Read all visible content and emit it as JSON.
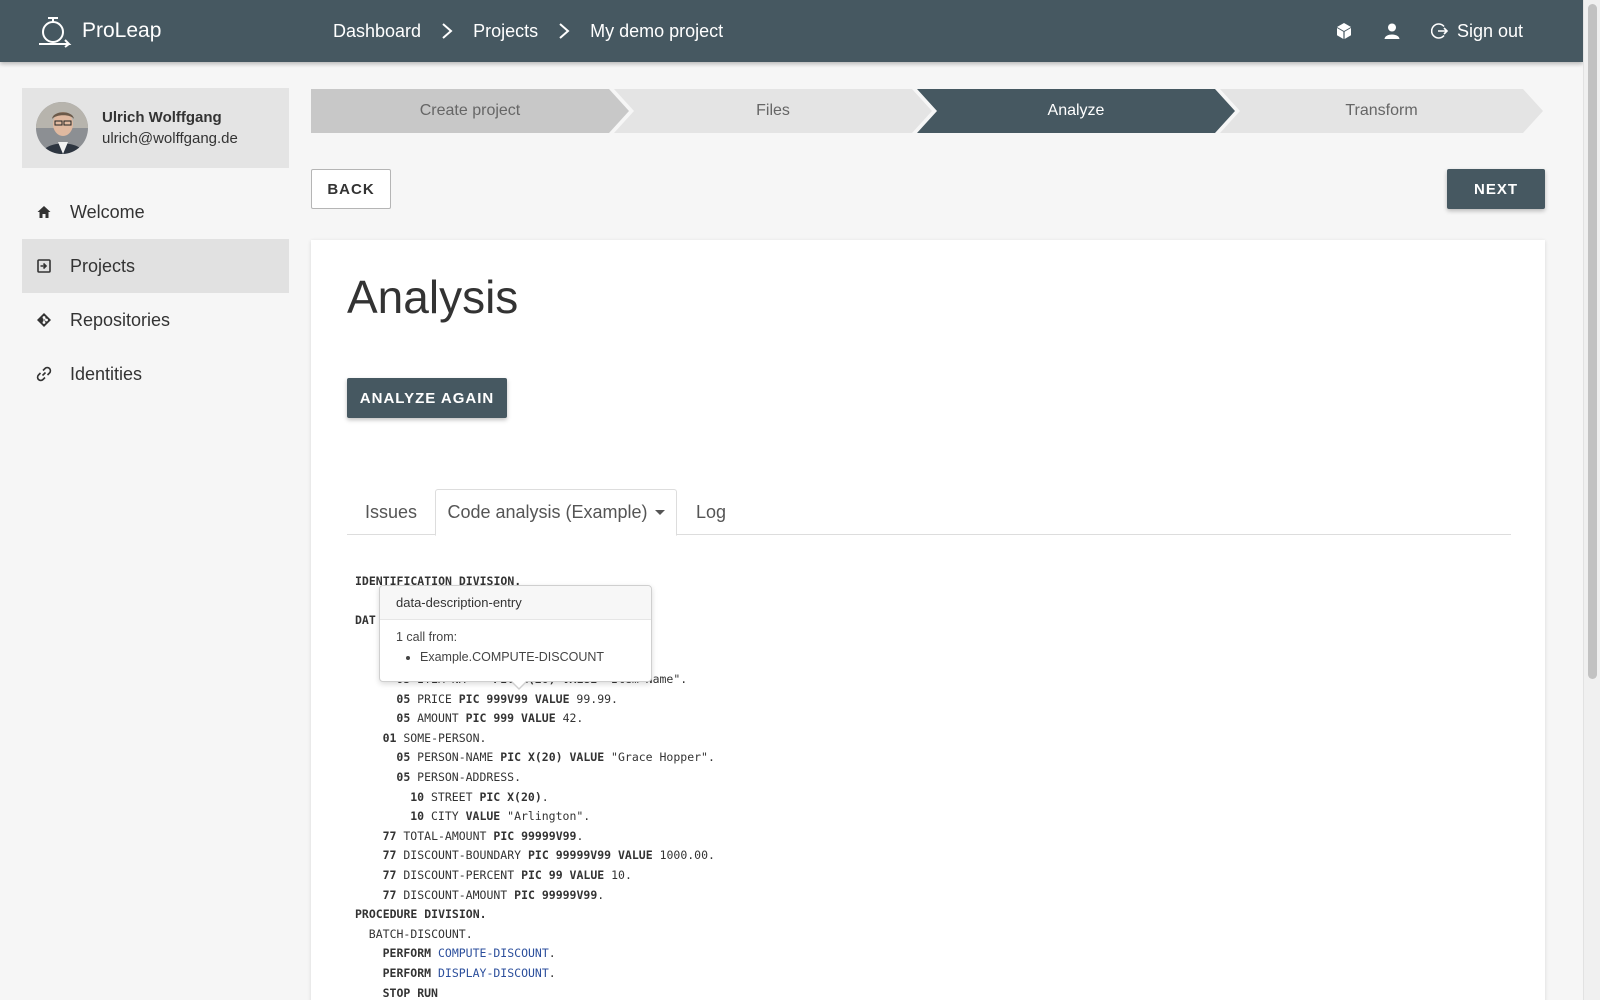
{
  "app": {
    "brand": "ProLeap"
  },
  "breadcrumb": [
    "Dashboard",
    "Projects",
    "My demo project"
  ],
  "topbar": {
    "sign_out": "Sign out",
    "icons": [
      "cube-icon",
      "user-icon",
      "sign-out-icon"
    ]
  },
  "user": {
    "name": "Ulrich Wolffgang",
    "email": "ulrich@wolffgang.de"
  },
  "sidebar": {
    "items": [
      {
        "label": "Welcome",
        "icon": "home-icon",
        "active": false
      },
      {
        "label": "Projects",
        "icon": "projects-icon",
        "active": true
      },
      {
        "label": "Repositories",
        "icon": "git-icon",
        "active": false
      },
      {
        "label": "Identities",
        "icon": "link-icon",
        "active": false
      }
    ]
  },
  "stepper": {
    "steps": [
      "Create project",
      "Files",
      "Analyze",
      "Transform"
    ],
    "active": "Analyze"
  },
  "actions": {
    "back": "BACK",
    "next": "NEXT"
  },
  "main": {
    "title": "Analysis",
    "analyze_again": "ANALYZE AGAIN",
    "tabs": [
      "Issues",
      "Code analysis (Example)",
      "Log"
    ],
    "active_tab": "Code analysis (Example)"
  },
  "code_lines": [
    {
      "indent": 0,
      "parts": [
        [
          "kw",
          "IDENTIFICATION DIVISION."
        ]
      ]
    },
    {
      "indent": 0,
      "parts": [
        [
          "kw",
          "DAT"
        ]
      ]
    },
    {
      "indent": 6,
      "parts": [
        [
          "kw",
          "05 "
        ],
        [
          "t",
          "ITEM-NA"
        ],
        [
          "t",
          "    "
        ],
        [
          "kw",
          "PIC X(20) VALUE "
        ],
        [
          "t",
          "\"Item Name\"."
        ]
      ]
    },
    {
      "indent": 6,
      "parts": [
        [
          "kw",
          "05 "
        ],
        [
          "t",
          "PRICE "
        ],
        [
          "kw",
          "PIC 999V99 VALUE "
        ],
        [
          "t",
          "99.99."
        ]
      ]
    },
    {
      "indent": 6,
      "parts": [
        [
          "kw",
          "05 "
        ],
        [
          "t",
          "AMOUNT "
        ],
        [
          "kw",
          "PIC 999 VALUE "
        ],
        [
          "t",
          "42."
        ]
      ]
    },
    {
      "indent": 4,
      "parts": [
        [
          "kw",
          "01 "
        ],
        [
          "t",
          "SOME-PERSON."
        ]
      ]
    },
    {
      "indent": 6,
      "parts": [
        [
          "kw",
          "05 "
        ],
        [
          "t",
          "PERSON-NAME "
        ],
        [
          "kw",
          "PIC X(20) VALUE "
        ],
        [
          "t",
          "\"Grace Hopper\"."
        ]
      ]
    },
    {
      "indent": 6,
      "parts": [
        [
          "kw",
          "05 "
        ],
        [
          "t",
          "PERSON-ADDRESS."
        ]
      ]
    },
    {
      "indent": 8,
      "parts": [
        [
          "kw",
          "10 "
        ],
        [
          "t",
          "STREET "
        ],
        [
          "kw",
          "PIC X(20)"
        ],
        [
          "t",
          "."
        ]
      ]
    },
    {
      "indent": 8,
      "parts": [
        [
          "kw",
          "10 "
        ],
        [
          "t",
          "CITY "
        ],
        [
          "kw",
          "VALUE "
        ],
        [
          "t",
          "\"Arlington\"."
        ]
      ]
    },
    {
      "indent": 4,
      "parts": [
        [
          "kw",
          "77 "
        ],
        [
          "t",
          "TOTAL-AMOUNT "
        ],
        [
          "kw",
          "PIC 99999V99"
        ],
        [
          "t",
          "."
        ]
      ]
    },
    {
      "indent": 4,
      "parts": [
        [
          "kw",
          "77 "
        ],
        [
          "t",
          "DISCOUNT-BOUNDARY "
        ],
        [
          "kw",
          "PIC 99999V99 VALUE "
        ],
        [
          "t",
          "1000.00."
        ]
      ]
    },
    {
      "indent": 4,
      "parts": [
        [
          "kw",
          "77 "
        ],
        [
          "t",
          "DISCOUNT-PERCENT "
        ],
        [
          "kw",
          "PIC 99 VALUE "
        ],
        [
          "t",
          "10."
        ]
      ]
    },
    {
      "indent": 4,
      "parts": [
        [
          "kw",
          "77 "
        ],
        [
          "t",
          "DISCOUNT-AMOUNT "
        ],
        [
          "kw",
          "PIC 99999V99"
        ],
        [
          "t",
          "."
        ]
      ]
    },
    {
      "indent": 0,
      "parts": [
        [
          "kw",
          "PROCEDURE DIVISION."
        ]
      ]
    },
    {
      "indent": 2,
      "parts": [
        [
          "t",
          "BATCH-DISCOUNT."
        ]
      ]
    },
    {
      "indent": 4,
      "parts": [
        [
          "kw",
          "PERFORM "
        ],
        [
          "link",
          "COMPUTE-DISCOUNT"
        ],
        [
          "t",
          "."
        ]
      ]
    },
    {
      "indent": 4,
      "parts": [
        [
          "kw",
          "PERFORM "
        ],
        [
          "link",
          "DISPLAY-DISCOUNT"
        ],
        [
          "t",
          "."
        ]
      ]
    },
    {
      "indent": 4,
      "parts": [
        [
          "kw",
          "STOP RUN"
        ]
      ]
    }
  ],
  "tooltip": {
    "title": "data-description-entry",
    "calls": "1 call from:",
    "items": [
      "Example.COMPUTE-DISCOUNT"
    ]
  },
  "colors": {
    "primary": "#465861",
    "step_done": "#c8c8c8",
    "step_pending": "#e4e4e4"
  }
}
